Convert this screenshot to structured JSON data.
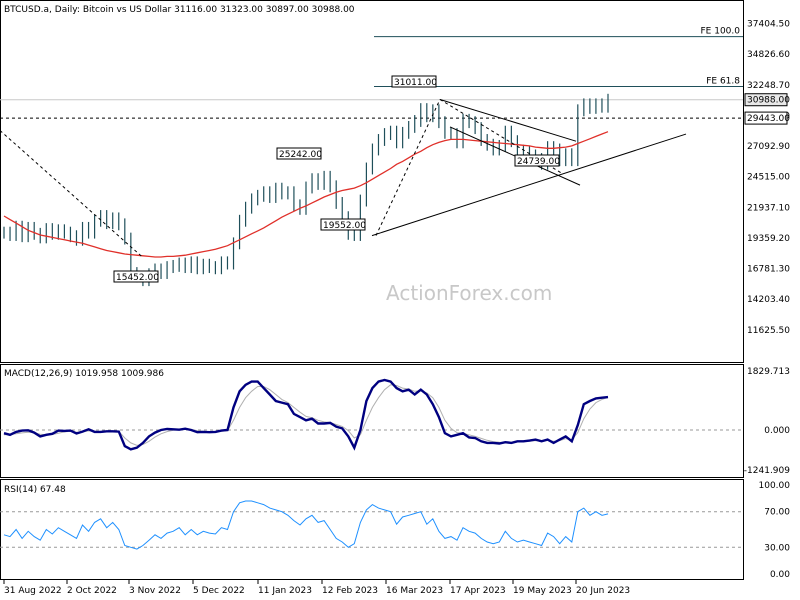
{
  "header": {
    "symbol": "BTCUSD.a",
    "timeframe": "Daily",
    "description": "Bitcoin vs US Dollar",
    "open": "31116.00",
    "high": "31323.00",
    "low": "30897.00",
    "close": "30988.00"
  },
  "watermark": "ActionForex.com",
  "colors": {
    "candle": "#1f4f5a",
    "ma": "#e0302a",
    "macd": "#000080",
    "macd_signal": "#b0b0b0",
    "rsi": "#1e90ff",
    "levels": "#1f4f5a",
    "trend": "#000000"
  },
  "chart_data": [
    {
      "type": "line",
      "name": "price",
      "x": [
        "31 Aug 2022",
        "2 Oct 2022",
        "3 Nov 2022",
        "5 Dec 2022",
        "11 Jan 2023",
        "12 Feb 2023",
        "16 Mar 2023",
        "17 Apr 2023",
        "19 May 2023",
        "20 Jun 2023"
      ],
      "y_ticks": [
        "37404.50",
        "34826.60",
        "32248.70",
        "29670.80",
        "27092.90",
        "24515.00",
        "21937.10",
        "19359.20",
        "16781.30",
        "14203.40",
        "11625.50"
      ],
      "ylim": [
        9500,
        37700
      ],
      "series": [
        {
          "name": "Close",
          "values": [
            19800,
            19600,
            20300,
            19500,
            20200,
            19700,
            19400,
            20100,
            19700,
            20000,
            19800,
            19500,
            19200,
            20200,
            19800,
            20800,
            21200,
            20600,
            21000,
            20500,
            19300,
            16400,
            16100,
            15800,
            16300,
            16700,
            16400,
            16900,
            17000,
            17200,
            16900,
            17300,
            16800,
            17100,
            16900,
            16800,
            17300,
            17200,
            18900,
            20800,
            21900,
            22600,
            22900,
            23200,
            22800,
            23500,
            23100,
            23200,
            22100,
            21800,
            23600,
            24300,
            23900,
            24500,
            23700,
            22300,
            21100,
            19700,
            19600,
            22500,
            25200,
            26800,
            27600,
            28100,
            28300,
            27400,
            28200,
            28700,
            29200,
            30200,
            29600,
            30100,
            29100,
            28200,
            28100,
            27400,
            29300,
            29100,
            28600,
            27600,
            27200,
            26800,
            27100,
            28300,
            27500,
            26700,
            26600,
            26300,
            26000,
            25600,
            27000,
            26800,
            25900,
            26400,
            25900,
            30100,
            30600,
            30300,
            30600,
            30400,
            30988
          ]
        },
        {
          "name": "MA",
          "values": [
            21200,
            20900,
            20600,
            20300,
            20000,
            19800,
            19600,
            19500,
            19400,
            19300,
            19200,
            19100,
            19000,
            18900,
            18750,
            18600,
            18450,
            18300,
            18200,
            18100,
            18000,
            17950,
            17900,
            17850,
            17800,
            17750,
            17750,
            17800,
            17800,
            17850,
            17900,
            18000,
            18100,
            18200,
            18300,
            18400,
            18550,
            18700,
            18950,
            19200,
            19450,
            19700,
            19950,
            20200,
            20500,
            20800,
            21100,
            21350,
            21600,
            21850,
            22050,
            22300,
            22550,
            22800,
            23000,
            23200,
            23350,
            23450,
            23550,
            23750,
            24000,
            24300,
            24600,
            24900,
            25200,
            25550,
            25800,
            26100,
            26400,
            26650,
            26950,
            27200,
            27400,
            27550,
            27650,
            27650,
            27650,
            27600,
            27550,
            27500,
            27450,
            27400,
            27350,
            27300,
            27250,
            27200,
            27150,
            27100,
            27000,
            26950,
            26900,
            26900,
            26950,
            27000,
            27100,
            27300,
            27500,
            27700,
            27900,
            28100,
            28300
          ]
        }
      ],
      "annotations": [
        {
          "label": "FE 100.0",
          "value": 36300
        },
        {
          "label": "FE 61.8",
          "value": 32100
        },
        {
          "label": "30988.00",
          "value": 30988
        },
        {
          "label": "29443.00",
          "value": 29443
        },
        {
          "label": "31011.00",
          "value": 31011
        },
        {
          "label": "25242.00",
          "value": 25242
        },
        {
          "label": "24739.00",
          "value": 24739
        },
        {
          "label": "19552.00",
          "value": 19552
        },
        {
          "label": "15452.00",
          "value": 15452
        }
      ]
    },
    {
      "type": "line",
      "name": "MACD(12,26,9)",
      "label": "MACD(12,26,9) 1019.958 1009.986",
      "y_ticks": [
        "1829.713",
        "0.000",
        "-1241.909"
      ],
      "ylim": [
        -1241.909,
        1829.713
      ],
      "series": [
        {
          "name": "MACD",
          "values": [
            -100,
            -150,
            -60,
            -20,
            -10,
            -80,
            -200,
            -150,
            -120,
            -20,
            -30,
            -20,
            -110,
            -50,
            20,
            -60,
            -60,
            -40,
            -40,
            -50,
            -500,
            -600,
            -550,
            -400,
            -200,
            -80,
            0,
            30,
            20,
            10,
            40,
            0,
            -70,
            -60,
            -70,
            -60,
            -20,
            0,
            700,
            1200,
            1400,
            1500,
            1500,
            1300,
            1100,
            900,
            850,
            800,
            500,
            400,
            300,
            350,
            200,
            200,
            220,
            100,
            50,
            -200,
            -550,
            0,
            900,
            1300,
            1500,
            1550,
            1500,
            1300,
            1200,
            1250,
            1100,
            1250,
            1100,
            800,
            400,
            -100,
            -200,
            -150,
            -100,
            -230,
            -250,
            -350,
            -400,
            -400,
            -420,
            -380,
            -400,
            -350,
            -350,
            -330,
            -300,
            -350,
            -300,
            -400,
            -300,
            -200,
            -350,
            150,
            800,
            900,
            980,
            1000,
            1019.958
          ]
        },
        {
          "name": "Signal",
          "values": [
            -150,
            -140,
            -120,
            -90,
            -70,
            -80,
            -130,
            -150,
            -140,
            -100,
            -60,
            -40,
            -70,
            -60,
            -30,
            -40,
            -50,
            -50,
            -45,
            -45,
            -250,
            -400,
            -480,
            -450,
            -350,
            -220,
            -120,
            -50,
            -10,
            5,
            20,
            15,
            -20,
            -40,
            -55,
            -60,
            -40,
            -20,
            300,
            700,
            1000,
            1200,
            1350,
            1350,
            1250,
            1100,
            950,
            850,
            700,
            550,
            420,
            380,
            300,
            250,
            230,
            170,
            110,
            -20,
            -250,
            -150,
            300,
            700,
            1000,
            1250,
            1400,
            1380,
            1300,
            1270,
            1200,
            1220,
            1150,
            1000,
            700,
            300,
            50,
            -80,
            -100,
            -150,
            -200,
            -260,
            -320,
            -360,
            -380,
            -390,
            -390,
            -370,
            -360,
            -350,
            -330,
            -340,
            -320,
            -350,
            -330,
            -270,
            -300,
            -80,
            350,
            650,
            850,
            950,
            1009.986
          ]
        }
      ]
    },
    {
      "type": "line",
      "name": "RSI(14)",
      "label": "RSI(14) 67.48",
      "y_ticks": [
        "100.00",
        "70.00",
        "30.00",
        "0.00"
      ],
      "ylim": [
        0,
        100
      ],
      "series": [
        {
          "name": "RSI",
          "values": [
            44,
            42,
            50,
            40,
            48,
            42,
            38,
            50,
            45,
            52,
            48,
            44,
            40,
            55,
            48,
            58,
            62,
            52,
            58,
            50,
            32,
            30,
            28,
            32,
            38,
            44,
            40,
            46,
            48,
            52,
            44,
            50,
            44,
            48,
            46,
            45,
            52,
            50,
            70,
            80,
            82,
            82,
            80,
            78,
            74,
            72,
            70,
            66,
            60,
            55,
            62,
            66,
            58,
            60,
            50,
            40,
            36,
            30,
            34,
            58,
            72,
            78,
            74,
            72,
            70,
            56,
            64,
            66,
            68,
            70,
            56,
            62,
            48,
            40,
            42,
            38,
            52,
            48,
            46,
            40,
            36,
            34,
            36,
            48,
            40,
            36,
            38,
            36,
            34,
            32,
            46,
            42,
            34,
            42,
            36,
            70,
            74,
            66,
            70,
            66,
            67.48
          ]
        }
      ]
    }
  ]
}
